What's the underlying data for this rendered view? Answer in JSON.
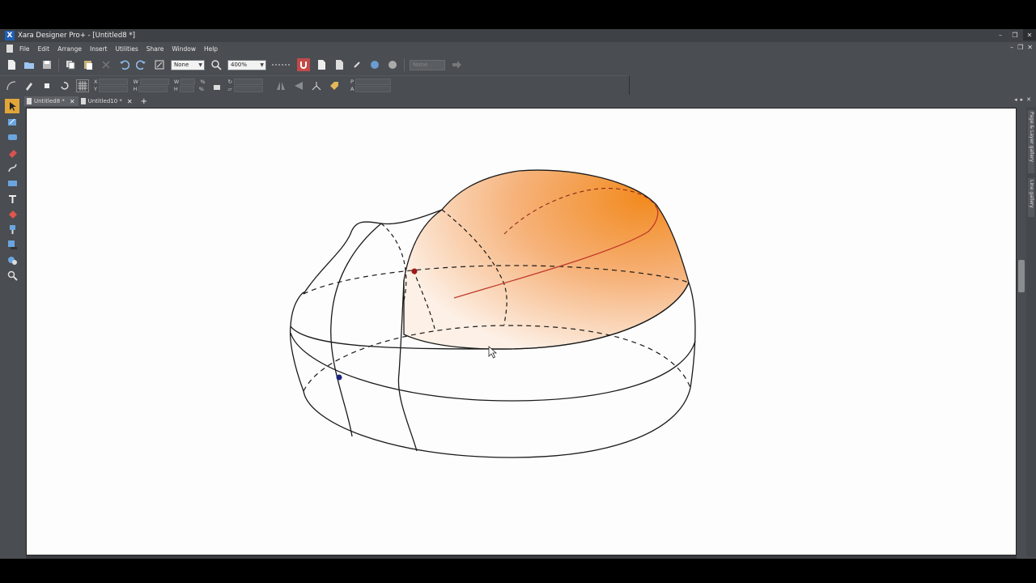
{
  "window": {
    "app_icon": "X",
    "title": "Xara Designer Pro+ - [Untitled8 *]",
    "controls": [
      "minimize-icon",
      "restore-icon",
      "close-icon"
    ]
  },
  "menubar": {
    "items": [
      "File",
      "Edit",
      "Arrange",
      "Insert",
      "Utilities",
      "Share",
      "Window",
      "Help"
    ]
  },
  "toolbar1": {
    "feather_value": "None",
    "zoom_value": "400%",
    "page_value": "None"
  },
  "toolbar2": {
    "labels": {
      "x": "X",
      "y": "Y",
      "w": "W",
      "h": "H",
      "w2": "W",
      "h2": "H",
      "pct1": "%",
      "pct2": "%",
      "p": "P",
      "a": "A"
    }
  },
  "tabs": [
    {
      "label": "Untitled8 *",
      "active": true
    },
    {
      "label": "Untitled10 *",
      "active": false
    }
  ],
  "tab_add": "+",
  "tab_nav": {
    "left": "◂",
    "right": "▸",
    "close": "✕"
  },
  "tools": [
    "selector-icon",
    "shape-editor-icon",
    "contour-icon",
    "eraser-icon",
    "freehand-icon",
    "rectangle-icon",
    "text-icon",
    "fill-icon",
    "transparency-icon",
    "shadow-icon",
    "bevel-icon",
    "zoom-icon"
  ],
  "right_gallery": [
    "Page & Layer gallery",
    "Line gallery"
  ],
  "colors": {
    "app_bg": "#4a4d51",
    "canvas_bg": "#fdfdfd",
    "accent_orange": "#f28a1e",
    "curve_red": "#c0392b",
    "handle_blue": "#1a237e",
    "handle_red": "#a01818"
  }
}
